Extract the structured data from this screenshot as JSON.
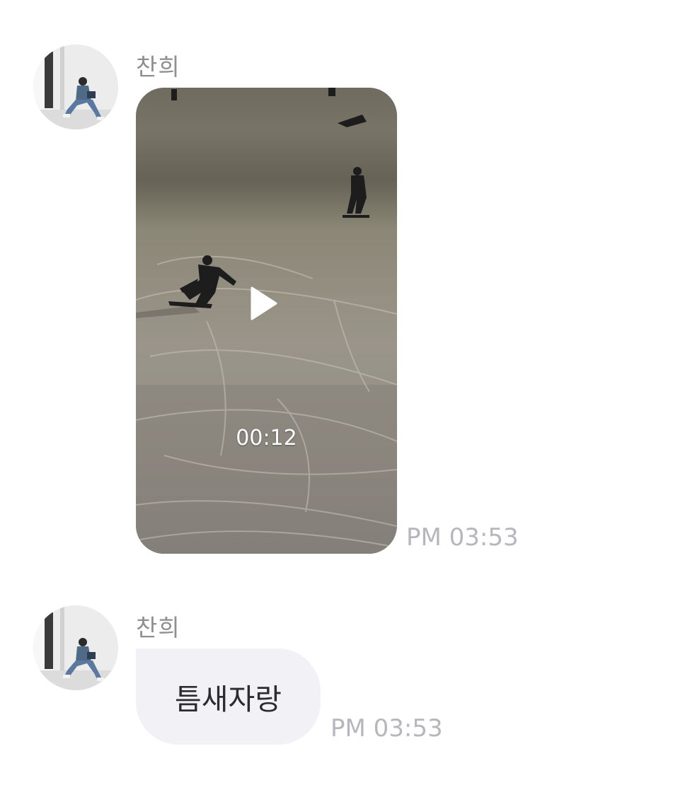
{
  "messages": [
    {
      "sender": "찬희",
      "type": "video",
      "duration": "00:12",
      "time": "PM 03:53",
      "avatar_icon": "profile-photo"
    },
    {
      "sender": "찬희",
      "type": "text",
      "text": "틈새자랑",
      "time": "PM 03:53",
      "avatar_icon": "profile-photo"
    }
  ],
  "colors": {
    "bubble_bg": "#f2f2f6",
    "timestamp": "#b6b6bc",
    "sender_name": "#8e8e93"
  }
}
